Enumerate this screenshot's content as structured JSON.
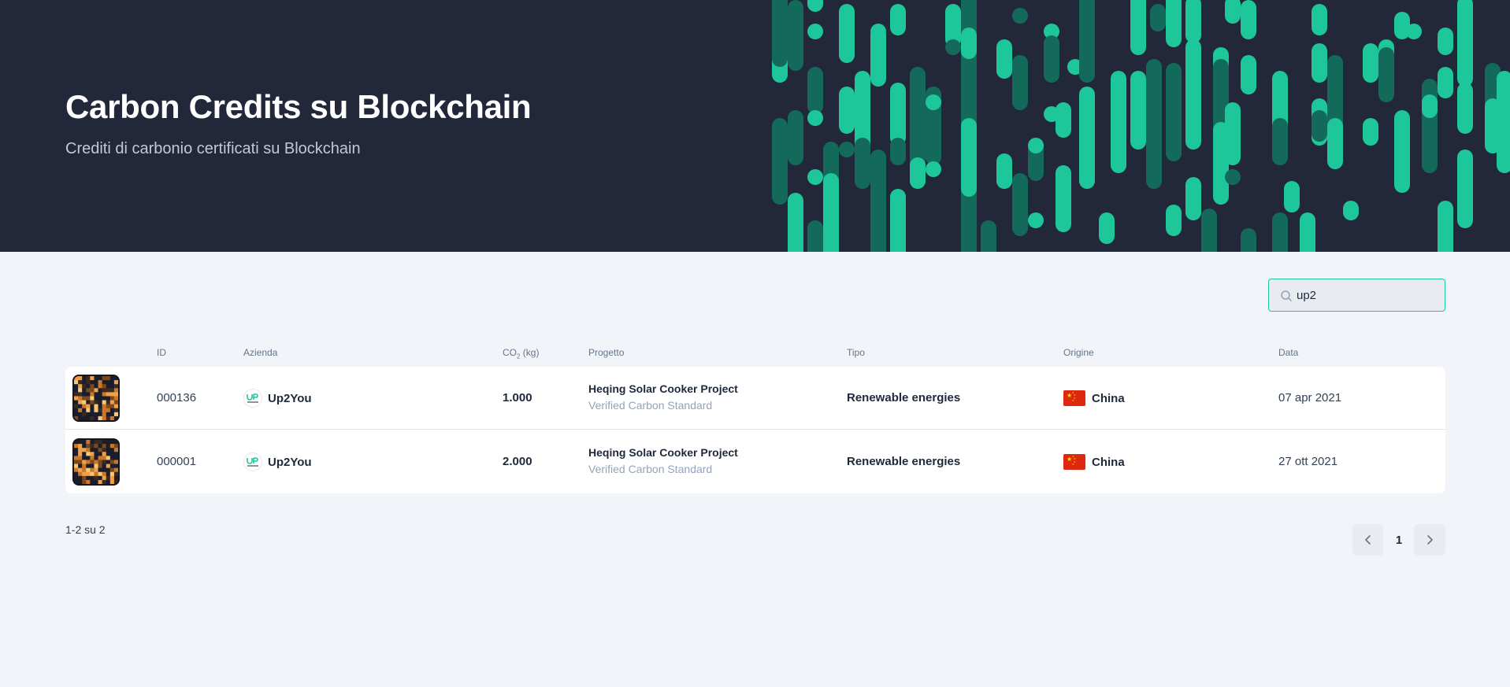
{
  "hero": {
    "title": "Carbon Credits su Blockchain",
    "subtitle": "Crediti di carbonio certificati su Blockchain"
  },
  "search": {
    "value": "up2",
    "icon": "search-icon"
  },
  "table": {
    "columns": {
      "id": "ID",
      "azienda": "Azienda",
      "co2": "CO",
      "co2_sub": "2",
      "co2_unit": " (kg)",
      "progetto": "Progetto",
      "tipo": "Tipo",
      "origine": "Origine",
      "data": "Data"
    },
    "rows": [
      {
        "id": "000136",
        "company": "Up2You",
        "co2": "1.000",
        "project": "Heqing Solar Cooker Project",
        "standard": "Verified Carbon Standard",
        "type": "Renewable energies",
        "origin": "China",
        "date": "07 apr 2021"
      },
      {
        "id": "000001",
        "company": "Up2You",
        "co2": "2.000",
        "project": "Heqing Solar Cooker Project",
        "standard": "Verified Carbon Standard",
        "type": "Renewable energies",
        "origin": "China",
        "date": "27 ott 2021"
      }
    ]
  },
  "pagination": {
    "summary": "1-2 su 2",
    "current_page": "1"
  },
  "colors": {
    "hero_bg": "#22273a",
    "accent": "#1ec79a",
    "accent_dark": "#146a5a",
    "page_bg": "#f1f5f9"
  }
}
